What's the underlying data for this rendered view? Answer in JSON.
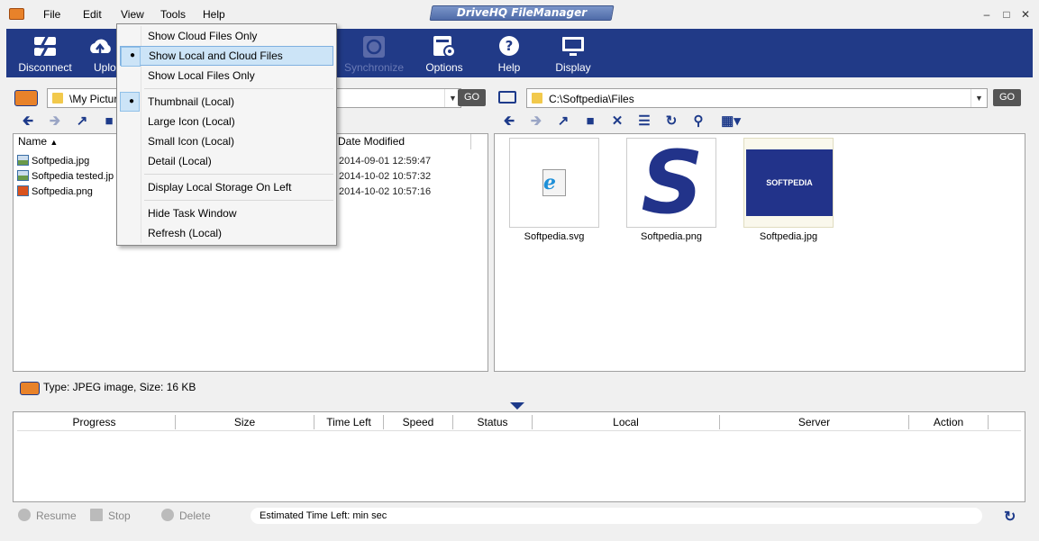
{
  "menubar": {
    "items": [
      "File",
      "Edit",
      "View",
      "Tools",
      "Help"
    ],
    "title": "DriveHQ FileManager"
  },
  "toolbar": {
    "disconnect": "Disconnect",
    "upload": "Uplo",
    "synchronize": "Synchronize",
    "options": "Options",
    "help": "Help",
    "display": "Display"
  },
  "local": {
    "path": "\\My Pictur",
    "go": "GO",
    "columns": {
      "name": "Name",
      "date": "Date Modified"
    },
    "files": [
      {
        "name": "Softpedia.jpg",
        "date": "2014-09-01 12:59:47"
      },
      {
        "name": "Softpedia tested.jp",
        "date": "2014-10-02 10:57:32"
      },
      {
        "name": "Softpedia.png",
        "date": "2014-10-02 10:57:16"
      }
    ]
  },
  "cloud": {
    "path": "C:\\Softpedia\\Files",
    "go": "GO",
    "thumbnails": [
      {
        "label": "Softpedia.svg"
      },
      {
        "label": "Softpedia.png"
      },
      {
        "label": "Softpedia.jpg"
      }
    ],
    "logo_text": "SOFTPEDIA"
  },
  "status": {
    "text": "Type: JPEG image, Size: 16 KB"
  },
  "transfers": {
    "columns": [
      "Progress",
      "Size",
      "Time Left",
      "Speed",
      "Status",
      "Local",
      "Server",
      "Action"
    ]
  },
  "bottom": {
    "resume": "Resume",
    "stop": "Stop",
    "delete": "Delete",
    "eta": "Estimated Time Left: min sec"
  },
  "view_menu": {
    "items": [
      {
        "label": "Show Cloud Files Only"
      },
      {
        "label": "Show Local and Cloud Files"
      },
      {
        "label": "Show Local Files Only"
      },
      {
        "label": "Thumbnail (Local)"
      },
      {
        "label": "Large Icon (Local)"
      },
      {
        "label": "Small Icon (Local)"
      },
      {
        "label": "Detail (Local)"
      },
      {
        "label": "Display Local Storage On Left"
      },
      {
        "label": "Hide Task Window"
      },
      {
        "label": "Refresh (Local)"
      }
    ]
  },
  "colors": {
    "toolbar_bg": "#213a87",
    "accent": "#1d3a8a",
    "menu_highlight": "#cce4f7"
  },
  "icons": [
    "app-icon",
    "disconnect-icon",
    "upload-icon",
    "synchronize-icon",
    "options-icon",
    "help-icon",
    "display-icon",
    "folder-icon",
    "back-icon",
    "forward-icon",
    "up-folder-icon",
    "new-folder-icon",
    "delete-icon",
    "properties-icon",
    "refresh-icon",
    "search-icon",
    "view-mode-icon"
  ]
}
